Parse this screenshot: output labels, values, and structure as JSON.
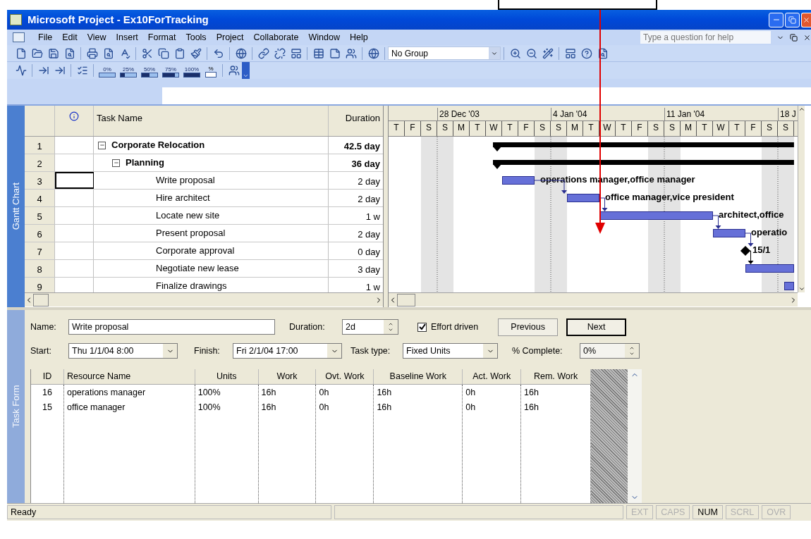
{
  "window": {
    "title": "Microsoft Project - Ex10ForTracking"
  },
  "menu": [
    {
      "label": "File"
    },
    {
      "label": "Edit"
    },
    {
      "label": "View"
    },
    {
      "label": "Insert"
    },
    {
      "label": "Format"
    },
    {
      "label": "Tools"
    },
    {
      "label": "Project"
    },
    {
      "label": "Collaborate"
    },
    {
      "label": "Window"
    },
    {
      "label": "Help"
    }
  ],
  "help_box": {
    "placeholder": "Type a question for help"
  },
  "group_box": {
    "value": "No Group"
  },
  "tracking_toolbar": {
    "percent_buttons": [
      "0%",
      "25%",
      "50%",
      "75%",
      "100%"
    ],
    "update_label": "%"
  },
  "view_bar": [
    {
      "label": "Gantt Chart",
      "selected": true
    },
    {
      "label": "Task Form",
      "selected": false
    }
  ],
  "task_table": {
    "columns": [
      "Task Name",
      "Duration"
    ],
    "rows": [
      {
        "id": "1",
        "name": "Corporate Relocation",
        "duration": "42.5 day",
        "selected": false,
        "expanded": true,
        "children": [
          {
            "id": "2",
            "name": "Planning",
            "duration": "36 day",
            "selected": false,
            "expanded": true,
            "children": [
              {
                "id": "3",
                "name": "Write proposal",
                "duration": "2 day",
                "selected": true
              },
              {
                "id": "4",
                "name": "Hire architect",
                "duration": "2 day",
                "selected": false
              },
              {
                "id": "5",
                "name": "Locate new site",
                "duration": "1 w",
                "selected": false
              },
              {
                "id": "6",
                "name": "Present proposal",
                "duration": "2 day",
                "selected": false
              },
              {
                "id": "7",
                "name": "Corporate approval",
                "duration": "0 day",
                "selected": false
              },
              {
                "id": "8",
                "name": "Negotiate new lease",
                "duration": "3 day",
                "selected": false
              },
              {
                "id": "9",
                "name": "Finalize drawings",
                "duration": "1 w",
                "selected": false
              }
            ]
          }
        ]
      }
    ]
  },
  "gantt": {
    "weeks": [
      "28 Dec '03",
      "4 Jan '04",
      "11 Jan '04",
      "18 J"
    ],
    "days": [
      "T",
      "F",
      "S",
      "S",
      "M",
      "T",
      "W",
      "T",
      "F",
      "S",
      "S",
      "M",
      "T",
      "W",
      "T",
      "F",
      "S",
      "S",
      "M",
      "T",
      "W",
      "T",
      "F",
      "S",
      "S"
    ],
    "bars": [
      {
        "kind": "summary"
      },
      {
        "kind": "summary"
      },
      {
        "kind": "task",
        "label": "operations manager,office manager"
      },
      {
        "kind": "task",
        "label": "office manager,vice president"
      },
      {
        "kind": "task",
        "label": "architect,office"
      },
      {
        "kind": "task",
        "label": "operatio"
      },
      {
        "kind": "milestone",
        "label": "15/1"
      },
      {
        "kind": "task"
      },
      {
        "kind": "task"
      }
    ]
  },
  "form": {
    "name": {
      "label": "Name:",
      "value": "Write proposal"
    },
    "duration": {
      "label": "Duration:",
      "value": "2d"
    },
    "effort_driven": {
      "label": "Effort driven",
      "checked": true
    },
    "buttons": [
      {
        "label": "Previous",
        "default": false
      },
      {
        "label": "Next",
        "default": true
      }
    ],
    "start": {
      "label": "Start:",
      "value": "Thu 1/1/04 8:00"
    },
    "finish": {
      "label": "Finish:",
      "value": "Fri 2/1/04 17:00"
    },
    "task_type": {
      "label": "Task type:",
      "value": "Fixed Units"
    },
    "complete": {
      "label": "% Complete:",
      "value": "0%"
    }
  },
  "resources": {
    "columns": [
      "ID",
      "Resource Name",
      "Units",
      "Work",
      "Ovt. Work",
      "Baseline Work",
      "Act. Work",
      "Rem. Work"
    ],
    "rows": [
      [
        "16",
        "operations manager",
        "100%",
        "16h",
        "0h",
        "16h",
        "0h",
        "16h"
      ],
      [
        "15",
        "office manager",
        "100%",
        "16h",
        "0h",
        "16h",
        "0h",
        "16h"
      ]
    ]
  },
  "status_bar": {
    "text": "Ready",
    "indicators": [
      {
        "label": "EXT",
        "on": false
      },
      {
        "label": "CAPS",
        "on": false
      },
      {
        "label": "NUM",
        "on": true
      },
      {
        "label": "SCRL",
        "on": false
      },
      {
        "label": "OVR",
        "on": false
      }
    ]
  }
}
